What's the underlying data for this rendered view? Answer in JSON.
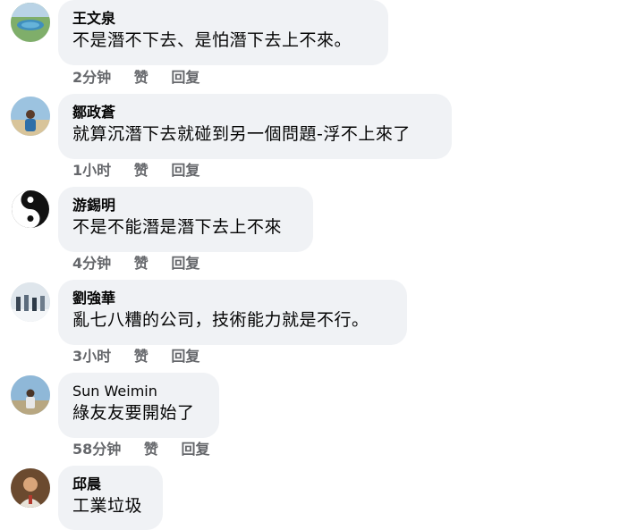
{
  "comments": [
    {
      "author": "王文泉",
      "text": "不是潛不下去、是怕潛下去上不來。",
      "time": "2分钟",
      "like": "赞",
      "reply": "回复"
    },
    {
      "author": "鄒政蒼",
      "text": "就算沉潛下去就碰到另一個問題-浮不上來了",
      "time": "1小时",
      "like": "赞",
      "reply": "回复"
    },
    {
      "author": "游錫明",
      "text": "不是不能潛是潛下去上不來",
      "time": "4分钟",
      "like": "赞",
      "reply": "回复"
    },
    {
      "author": "劉強華",
      "text": "亂七八糟的公司，技術能力就是不行。",
      "time": "3小时",
      "like": "赞",
      "reply": "回复"
    },
    {
      "author": "Sun Weimin",
      "text": "綠友友要開始了",
      "time": "58分钟",
      "like": "赞",
      "reply": "回复"
    },
    {
      "author": "邱晨",
      "text": "工業垃圾",
      "time": "",
      "like": "",
      "reply": ""
    }
  ],
  "colors": {
    "bubble": "#f0f2f5",
    "meta": "#65676b",
    "text": "#050505"
  }
}
